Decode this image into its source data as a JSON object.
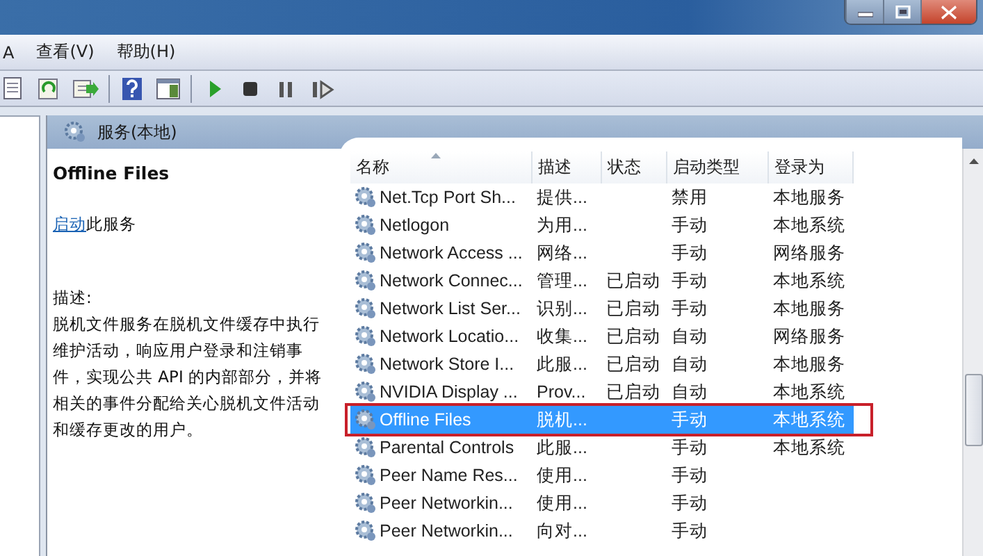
{
  "window": {
    "controls": [
      {
        "kind": "minimize"
      },
      {
        "kind": "maximize"
      },
      {
        "kind": "close"
      }
    ]
  },
  "menu": [
    {
      "label": "A"
    },
    {
      "label": "查看(V)"
    },
    {
      "label": "帮助(H)"
    }
  ],
  "toolbar": [
    {
      "kind": "document"
    },
    {
      "kind": "refresh"
    },
    {
      "kind": "export"
    },
    {
      "kind": "help"
    },
    {
      "kind": "panel"
    },
    {
      "kind": "play"
    },
    {
      "kind": "stop"
    },
    {
      "kind": "pause"
    },
    {
      "kind": "resume"
    }
  ],
  "pane": {
    "title": "服务(本地)"
  },
  "details": {
    "name": "Offline Files",
    "action_link": "启动",
    "action_rest": "此服务",
    "description_label": "描述:",
    "description": "脱机文件服务在脱机文件缓存中执行维护活动，响应用户登录和注销事件，实现公共 API 的内部部分，并将相关的事件分配给关心脱机文件活动和缓存更改的用户。"
  },
  "table": {
    "columns": [
      {
        "label": "名称",
        "sorted": true
      },
      {
        "label": "描述",
        "sorted": false
      },
      {
        "label": "状态",
        "sorted": false
      },
      {
        "label": "启动类型",
        "sorted": false
      },
      {
        "label": "登录为",
        "sorted": false
      }
    ],
    "rows": [
      {
        "cells": [
          "Net.Tcp Port Sh...",
          "提供...",
          "",
          "禁用",
          "本地服务"
        ],
        "selected": false,
        "marked": false
      },
      {
        "cells": [
          "Netlogon",
          "为用...",
          "",
          "手动",
          "本地系统"
        ],
        "selected": false,
        "marked": false
      },
      {
        "cells": [
          "Network Access ...",
          "网络...",
          "",
          "手动",
          "网络服务"
        ],
        "selected": false,
        "marked": false
      },
      {
        "cells": [
          "Network Connec...",
          "管理...",
          "已启动",
          "手动",
          "本地系统"
        ],
        "selected": false,
        "marked": false
      },
      {
        "cells": [
          "Network List Ser...",
          "识别...",
          "已启动",
          "手动",
          "本地服务"
        ],
        "selected": false,
        "marked": false
      },
      {
        "cells": [
          "Network Locatio...",
          "收集...",
          "已启动",
          "自动",
          "网络服务"
        ],
        "selected": false,
        "marked": false
      },
      {
        "cells": [
          "Network Store I...",
          "此服...",
          "已启动",
          "自动",
          "本地服务"
        ],
        "selected": false,
        "marked": false
      },
      {
        "cells": [
          "NVIDIA Display ...",
          "Prov...",
          "已启动",
          "自动",
          "本地系统"
        ],
        "selected": false,
        "marked": false
      },
      {
        "cells": [
          "Offline Files",
          "脱机...",
          "",
          "手动",
          "本地系统"
        ],
        "selected": true,
        "marked": true
      },
      {
        "cells": [
          "Parental Controls",
          "此服...",
          "",
          "手动",
          "本地系统"
        ],
        "selected": false,
        "marked": false
      },
      {
        "cells": [
          "Peer Name Res...",
          "使用...",
          "",
          "手动",
          ""
        ],
        "selected": false,
        "marked": false
      },
      {
        "cells": [
          "Peer Networkin...",
          "使用...",
          "",
          "手动",
          ""
        ],
        "selected": false,
        "marked": false
      },
      {
        "cells": [
          "Peer Networkin...",
          "向对...",
          "",
          "手动",
          ""
        ],
        "selected": false,
        "marked": false
      }
    ]
  }
}
